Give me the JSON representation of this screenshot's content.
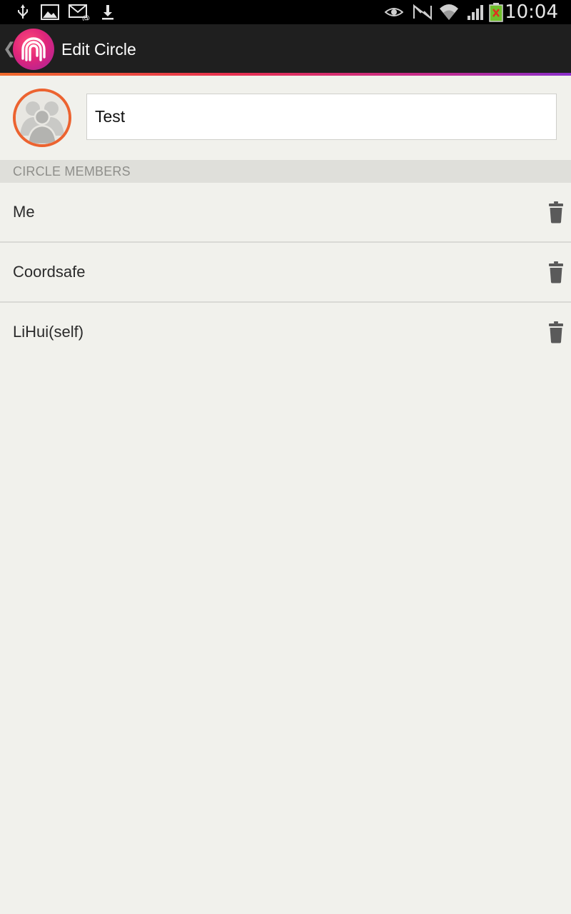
{
  "status_bar": {
    "time": "10:04",
    "icons": [
      "usb-icon",
      "image-icon",
      "email-icon",
      "download-icon",
      "eye-icon",
      "nfc-icon",
      "wifi-icon",
      "signal-icon",
      "battery-icon"
    ]
  },
  "action_bar": {
    "title": "Edit Circle",
    "logo": "life360-logo"
  },
  "circle": {
    "name_value": "Test",
    "avatar": "group-avatar-icon"
  },
  "members_section": {
    "header": "CIRCLE MEMBERS",
    "members": [
      {
        "name": "Me"
      },
      {
        "name": "Coordsafe"
      },
      {
        "name": "LiHui(self)"
      }
    ]
  },
  "colors": {
    "accent_orange": "#ec6330",
    "gradient_start": "#f06a2c",
    "gradient_end": "#8a2fcb",
    "background": "#f1f1ec"
  }
}
